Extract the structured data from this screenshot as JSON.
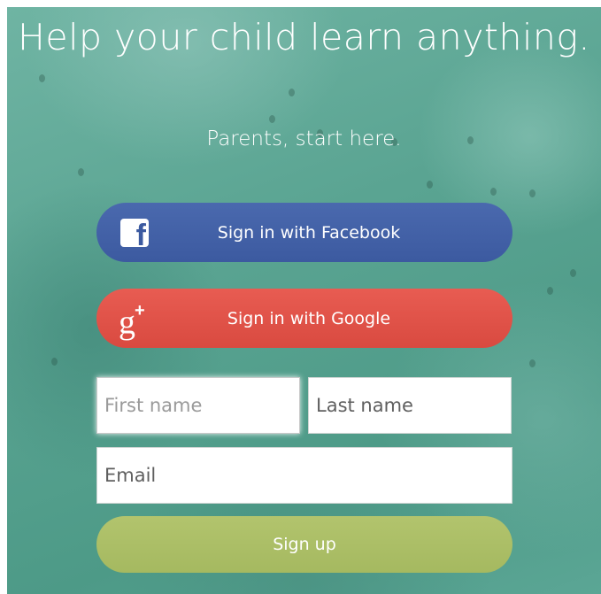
{
  "hero": {
    "headline": "Help your child learn anything.",
    "subheadline": "Parents, start here."
  },
  "social": {
    "facebook": {
      "label": "Sign in with Facebook",
      "icon": "facebook-icon",
      "color": "#3c5aa0"
    },
    "google": {
      "label": "Sign in with Google",
      "icon": "google-plus-icon",
      "color": "#d94a40"
    }
  },
  "form": {
    "first_name": {
      "value": "",
      "placeholder": "First name"
    },
    "last_name": {
      "value": "",
      "placeholder": "Last name"
    },
    "email": {
      "value": "",
      "placeholder": "Email"
    },
    "submit_label": "Sign up",
    "submit_color": "#a8bb62"
  },
  "theme": {
    "background": "#5ea897",
    "text": "#ffffff"
  }
}
